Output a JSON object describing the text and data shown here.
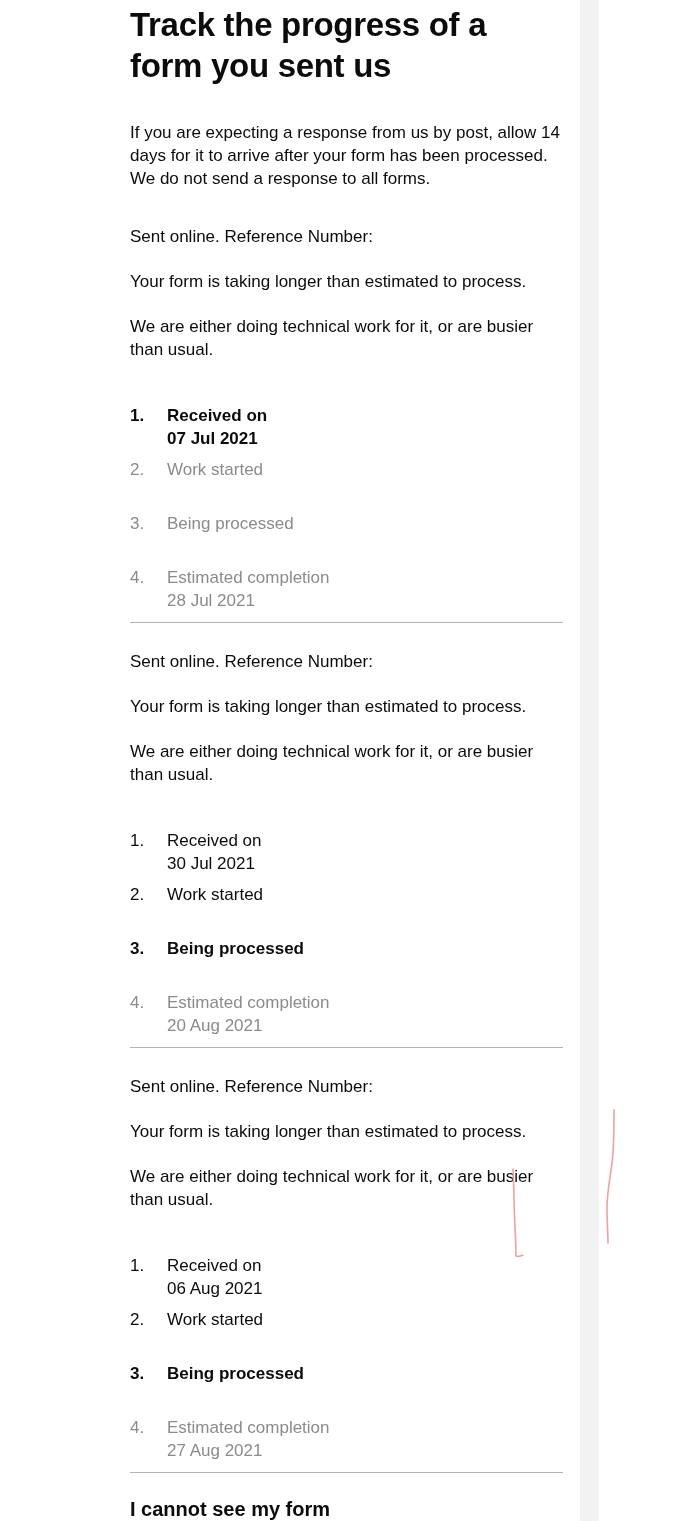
{
  "page": {
    "title": "Track the progress of a form you sent us",
    "intro": "If you are expecting a response from us by post, allow 14 days for it to arrive after your form has been processed. We do not send a response to all forms."
  },
  "forms": [
    {
      "reference": "Sent online. Reference Number:",
      "notices": [
        "Your form is taking longer than estimated to process.",
        "We are either doing technical work for it, or are busier than usual."
      ],
      "steps": [
        {
          "number": "1.",
          "label": "Received on",
          "date": "07 Jul 2021",
          "completed": true,
          "current": true
        },
        {
          "number": "2.",
          "label": "Work started",
          "completed": false,
          "current": false
        },
        {
          "number": "3.",
          "label": "Being processed",
          "completed": false,
          "current": false
        },
        {
          "number": "4.",
          "label": "Estimated completion",
          "date": "28 Jul 2021",
          "completed": false,
          "current": false
        }
      ]
    },
    {
      "reference": "Sent online. Reference Number:",
      "notices": [
        "Your form is taking longer than estimated to process.",
        "We are either doing technical work for it, or are busier than usual."
      ],
      "steps": [
        {
          "number": "1.",
          "label": "Received on",
          "date": "30 Jul 2021",
          "completed": true,
          "current": false
        },
        {
          "number": "2.",
          "label": "Work started",
          "completed": true,
          "current": false
        },
        {
          "number": "3.",
          "label": "Being processed",
          "completed": true,
          "current": true
        },
        {
          "number": "4.",
          "label": "Estimated completion",
          "date": "20 Aug 2021",
          "completed": false,
          "current": false
        }
      ]
    },
    {
      "reference": "Sent online. Reference Number:",
      "notices": [
        "Your form is taking longer than estimated to process.",
        "We are either doing technical work for it, or are busier than usual."
      ],
      "steps": [
        {
          "number": "1.",
          "label": "Received on",
          "date": "06 Aug 2021",
          "completed": true,
          "current": false
        },
        {
          "number": "2.",
          "label": "Work started",
          "completed": true,
          "current": false
        },
        {
          "number": "3.",
          "label": "Being processed",
          "completed": true,
          "current": true
        },
        {
          "number": "4.",
          "label": "Estimated completion",
          "date": "27 Aug 2021",
          "completed": false,
          "current": false
        }
      ]
    }
  ],
  "help": {
    "heading": "I cannot see my form"
  }
}
